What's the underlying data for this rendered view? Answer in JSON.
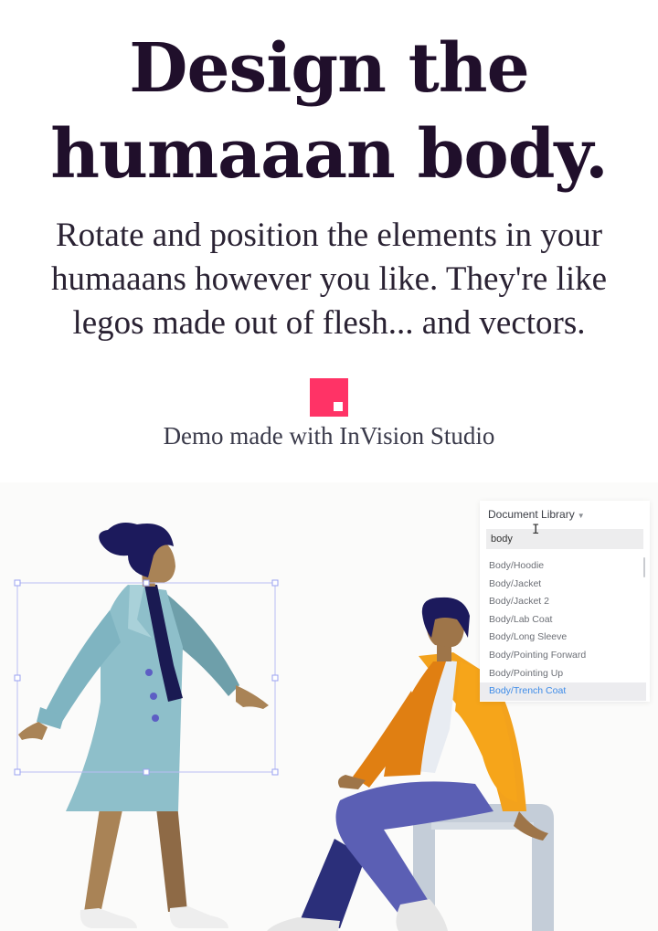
{
  "hero": {
    "title_line1": "Design the",
    "title_line2": "humaaan body.",
    "subtitle_line1": "Rotate and position the elements in your",
    "subtitle_line2": "humaaans however you like. They're like",
    "subtitle_line3": "legos made out of flesh... and vectors.",
    "demo_credit": "Demo made with InVision Studio"
  },
  "colors": {
    "headline": "#200f2b",
    "brand_accent": "#ff3366",
    "selection": "#9aa0f0",
    "selected_item": "#3d8be8"
  },
  "library_panel": {
    "title": "Document Library",
    "dropdown_icon": "caret-down-icon",
    "search_value": "body",
    "items": [
      "Body/Hoodie",
      "Body/Jacket",
      "Body/Jacket 2",
      "Body/Lab Coat",
      "Body/Long Sleeve",
      "Body/Pointing Forward",
      "Body/Pointing Up",
      "Body/Trench Coat"
    ],
    "selected_item": "Body/Trench Coat"
  }
}
